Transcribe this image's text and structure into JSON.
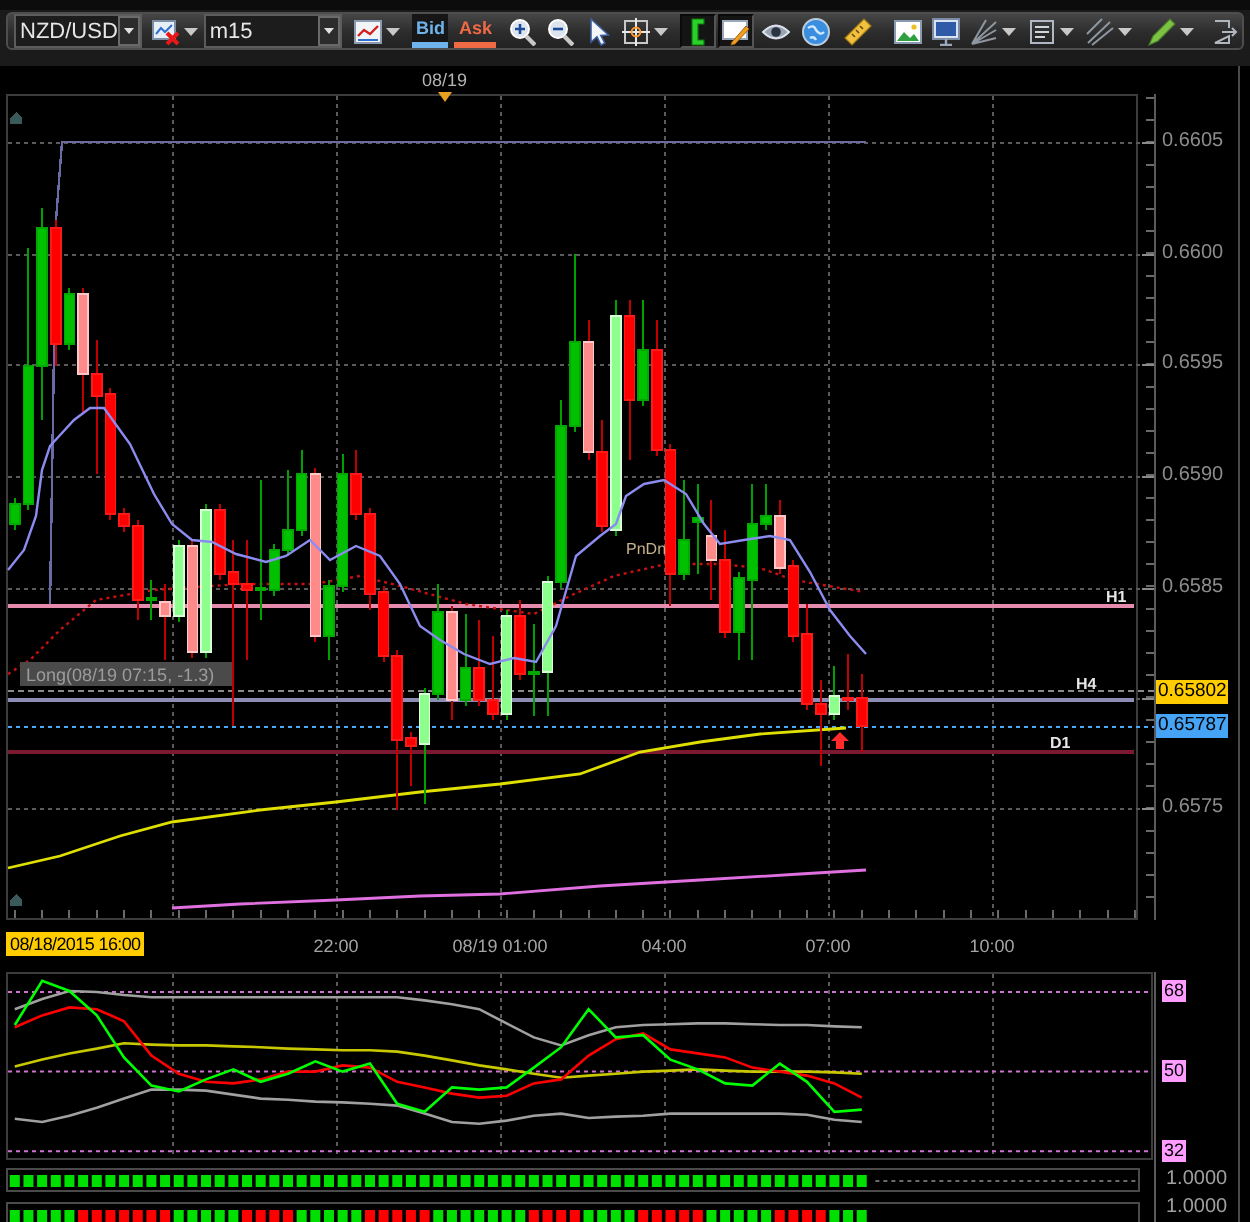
{
  "toolbar": {
    "items": [
      {
        "kind": "select",
        "value": "NZD/USD"
      },
      {
        "kind": "delete",
        "dropdown": true,
        "selected": false
      },
      {
        "kind": "select",
        "value": "m15"
      },
      {
        "kind": "charttype",
        "dropdown": true,
        "selected": false
      },
      {
        "kind": "side",
        "label": "Bid",
        "selected": true,
        "color": "#6fb3ec"
      },
      {
        "kind": "side",
        "label": "Ask",
        "selected": false,
        "color": "#ee6a45"
      },
      {
        "kind": "zoomin",
        "dropdown": false,
        "selected": false
      },
      {
        "kind": "zoomout",
        "dropdown": false,
        "selected": false
      },
      {
        "kind": "pointer",
        "dropdown": false,
        "selected": false
      },
      {
        "kind": "crosshair",
        "dropdown": true,
        "selected": false
      },
      {
        "kind": "bracket",
        "dropdown": false,
        "selected": true
      },
      {
        "kind": "note",
        "dropdown": false,
        "selected": true
      },
      {
        "kind": "eye",
        "dropdown": false,
        "selected": false
      },
      {
        "kind": "globe",
        "dropdown": false,
        "selected": false
      },
      {
        "kind": "ruler",
        "dropdown": false,
        "selected": false
      },
      {
        "kind": "picture",
        "dropdown": false,
        "selected": false
      },
      {
        "kind": "monitor",
        "dropdown": false,
        "selected": false
      },
      {
        "kind": "fan",
        "dropdown": true,
        "selected": false
      },
      {
        "kind": "list",
        "dropdown": true,
        "selected": false
      },
      {
        "kind": "lines",
        "dropdown": true,
        "selected": false
      },
      {
        "kind": "pen",
        "dropdown": true,
        "selected": false
      },
      {
        "kind": "exit",
        "dropdown": false,
        "selected": false
      }
    ]
  },
  "chart": {
    "date_marker": "08/19",
    "price_ticks": [
      "0.6605",
      "0.6600",
      "0.6595",
      "0.6590",
      "0.6585",
      "0.6575"
    ],
    "price_badges": [
      {
        "label": "0.65802",
        "color": "#ffcc00"
      },
      {
        "label": "0.65787",
        "color": "#45a4f5"
      }
    ],
    "level_lines": [
      {
        "label": "H1",
        "color": "#e58cae"
      },
      {
        "label": "H4",
        "color": "#8c8cb4"
      },
      {
        "label": "D1",
        "color": "#7c1830"
      }
    ],
    "trade_label": "Long(08/19 07:15, -1.3)",
    "pattern_label": "PnDn"
  },
  "time_axis": {
    "cursor_time": "08/18/2015 16:00",
    "ticks": [
      "22:00",
      "08/19 01:00",
      "04:00",
      "07:00",
      "10:00"
    ]
  },
  "oscillator": {
    "chart_data": {
      "type": "line",
      "grid": true,
      "ylim": [
        30,
        72.5
      ],
      "yticks": [
        {
          "value": 68,
          "label": "68"
        },
        {
          "value": 50,
          "label": "50"
        },
        {
          "value": 32,
          "label": "32"
        }
      ],
      "series": [
        {
          "color": "#a0a0a0",
          "values": [
            64.1,
            66.4,
            68.2,
            68,
            67.3,
            66.8,
            66.8,
            66.8,
            66.8,
            66.8,
            66.8,
            66.8,
            66.8,
            66.8,
            66.8,
            66.1,
            65.2,
            64.1,
            60.9,
            57.7,
            55.9,
            58.2,
            60,
            60.5,
            60.7,
            60.9,
            60.9,
            60.7,
            60.5,
            60.5,
            60.2,
            60
          ]
        },
        {
          "color": "#a0a0a0",
          "values": [
            39.3,
            38.6,
            40,
            41.8,
            43.9,
            45.9,
            45.9,
            45.7,
            44.8,
            43.9,
            43.6,
            43.2,
            43,
            42.7,
            42.3,
            40.5,
            38.6,
            38.2,
            38.9,
            40,
            40.5,
            39.5,
            39.8,
            40,
            40.5,
            40.5,
            40.5,
            40.5,
            40.5,
            40.2,
            39.1,
            38.6
          ]
        },
        {
          "color": "#c8c800",
          "values": [
            51.1,
            52.7,
            54.1,
            55.2,
            56.4,
            56.1,
            55.9,
            55.9,
            55.7,
            55.5,
            55.2,
            55,
            54.8,
            54.8,
            54.5,
            53.6,
            52.5,
            51.4,
            50.5,
            49.5,
            48.6,
            49.1,
            49.5,
            50,
            50.2,
            50.5,
            50.2,
            50,
            50,
            50,
            49.8,
            49.5
          ]
        },
        {
          "color": "#ff0000",
          "values": [
            60,
            62.7,
            64.5,
            64.1,
            61.4,
            53.6,
            49.5,
            47.7,
            47.3,
            48.2,
            50,
            50,
            51.4,
            50.9,
            47.7,
            46.4,
            45,
            44.1,
            44.5,
            47.3,
            48.2,
            53.6,
            57.3,
            58.6,
            55,
            54.1,
            53.2,
            50.9,
            50,
            49.1,
            47.3,
            44.1
          ]
        },
        {
          "color": "#00ff00",
          "values": [
            60.5,
            70.5,
            68.2,
            62.7,
            53.2,
            46.8,
            45.5,
            48.2,
            50.5,
            47.7,
            49.5,
            52.3,
            50,
            51.8,
            42.7,
            40.9,
            46.4,
            45.9,
            46.4,
            50.9,
            55.5,
            64.1,
            57.7,
            58.2,
            52.7,
            50.5,
            47.3,
            46.8,
            51.8,
            47.7,
            40.9,
            41.4
          ]
        }
      ]
    }
  },
  "indicator_strips": [
    {
      "label": "1.0000"
    },
    {
      "label": "1.0000"
    }
  ]
}
